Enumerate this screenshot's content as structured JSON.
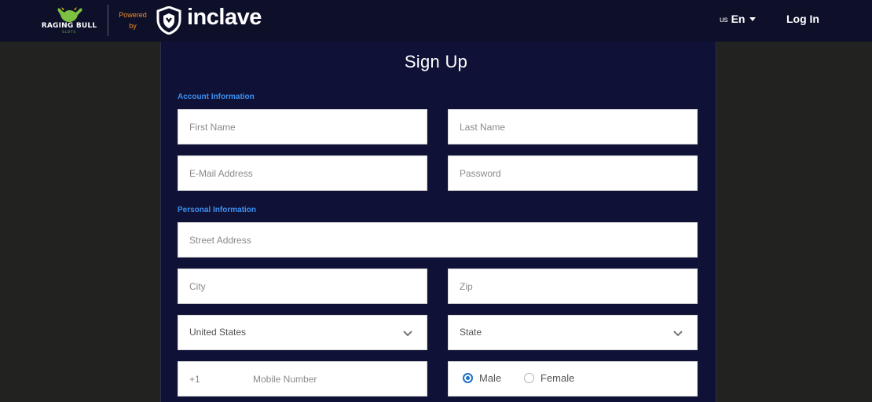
{
  "header": {
    "brand_name": "RAGING BULL",
    "brand_sub": "SLOTS",
    "powered_by": "Powered by",
    "partner_name": "inclave",
    "lang_flag": "us",
    "lang_code": "En",
    "login_label": "Log In"
  },
  "form": {
    "title": "Sign Up",
    "sections": {
      "account": "Account Information",
      "personal": "Personal Information"
    },
    "fields": {
      "first_name": "First Name",
      "last_name": "Last Name",
      "email": "E-Mail Address",
      "password": "Password",
      "street": "Street Address",
      "city": "City",
      "zip": "Zip",
      "country": "United States",
      "state": "State",
      "phone_prefix": "+1",
      "mobile": "Mobile Number"
    },
    "gender": {
      "options": [
        "Male",
        "Female"
      ],
      "selected": "Male"
    }
  },
  "colors": {
    "header_bg": "#0d1028",
    "panel_bg": "#0f1236",
    "page_bg": "#222220",
    "section_label": "#3d8ff0",
    "powered_by": "#f18a2b",
    "radio_selected": "#1e6fc8"
  },
  "icons": {
    "brand": "bull-logo-icon",
    "partner": "inclave-shield-icon",
    "dropdown": "chevron-down-icon",
    "lang_caret": "caret-down-icon"
  }
}
